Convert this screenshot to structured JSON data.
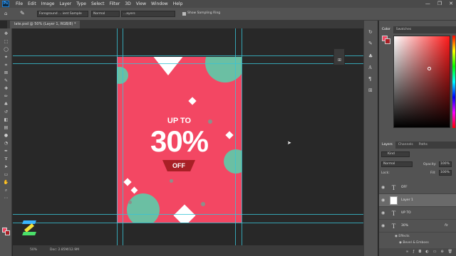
{
  "app": {
    "logo": "Ps"
  },
  "menu": [
    "File",
    "Edit",
    "Image",
    "Layer",
    "Type",
    "Select",
    "Filter",
    "3D",
    "View",
    "Window",
    "Help"
  ],
  "window_controls": [
    "—",
    "❐",
    "✕"
  ],
  "options_bar": {
    "source": "Foreground ... ient Sample",
    "mode": "Normal",
    "layers": "...ayers",
    "sampling_ring_label": "Show Sampling Ring",
    "sampling_ring_checked": true
  },
  "document_tab": {
    "title": "late.psd @ 50% (Layer 1, RGB/8) *"
  },
  "artboard": {
    "upto": "UP TO",
    "percent": "30%",
    "off": "OFF",
    "bg_color": "#f34763",
    "circle_color": "#6bbfa3",
    "badge_color": "#a82026"
  },
  "status": {
    "zoom": "50%",
    "doc": "Doc: 2.85M/12.9M"
  },
  "color_panel": {
    "tabs": [
      "Color",
      "Swatches"
    ],
    "fg": "#f34763",
    "bg": "#a82026"
  },
  "layers_panel": {
    "tabs": [
      "Layers",
      "Channels",
      "Paths"
    ],
    "kind_label": "Kind",
    "blend_mode": "Normal",
    "opacity_label": "Opacity:",
    "opacity": "100%",
    "lock_label": "Lock:",
    "fill_label": "Fill:",
    "fill": "100%",
    "layers": [
      {
        "name": "OFF",
        "kind": "text"
      },
      {
        "name": "Layer 1",
        "kind": "image",
        "selected": true
      },
      {
        "name": "UP TO",
        "kind": "text"
      },
      {
        "name": "30%",
        "kind": "text",
        "fx": true
      }
    ],
    "effects_label": "Effects",
    "effect_bevel": "Bevel & Emboss"
  }
}
